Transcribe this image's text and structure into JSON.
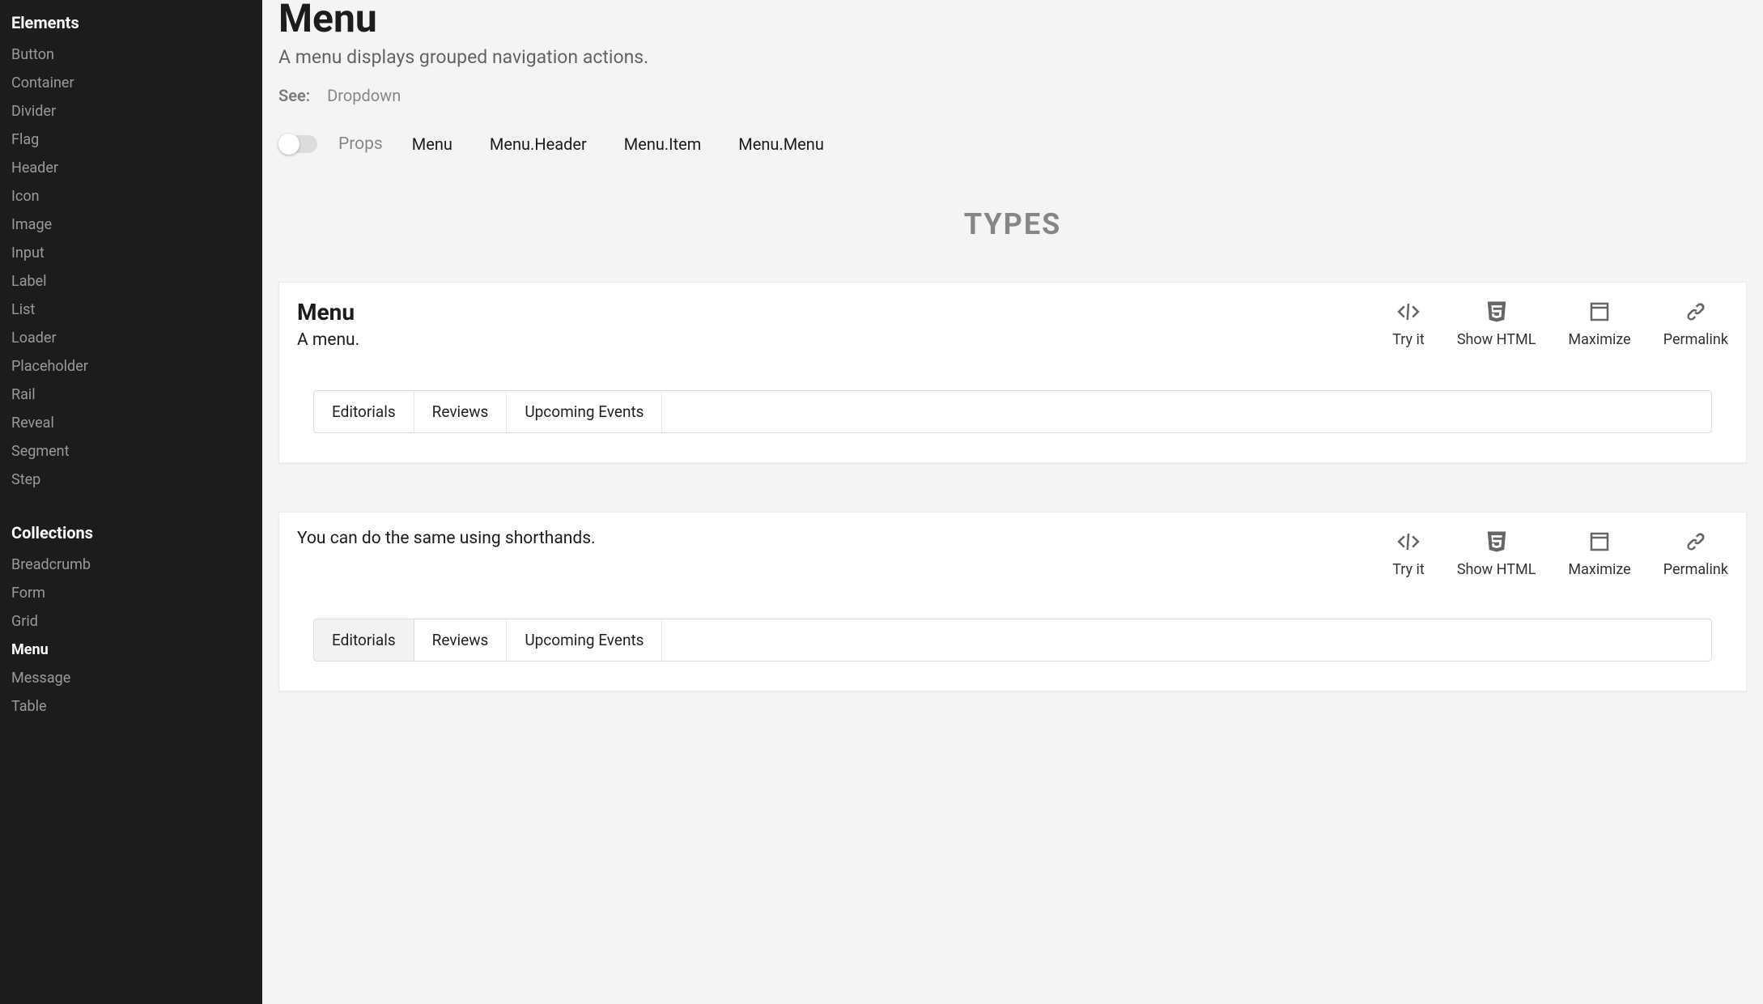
{
  "sidebar": {
    "sections": [
      {
        "title": "Elements",
        "items": [
          {
            "label": "Button",
            "active": false
          },
          {
            "label": "Container",
            "active": false
          },
          {
            "label": "Divider",
            "active": false
          },
          {
            "label": "Flag",
            "active": false
          },
          {
            "label": "Header",
            "active": false
          },
          {
            "label": "Icon",
            "active": false
          },
          {
            "label": "Image",
            "active": false
          },
          {
            "label": "Input",
            "active": false
          },
          {
            "label": "Label",
            "active": false
          },
          {
            "label": "List",
            "active": false
          },
          {
            "label": "Loader",
            "active": false
          },
          {
            "label": "Placeholder",
            "active": false
          },
          {
            "label": "Rail",
            "active": false
          },
          {
            "label": "Reveal",
            "active": false
          },
          {
            "label": "Segment",
            "active": false
          },
          {
            "label": "Step",
            "active": false
          }
        ]
      },
      {
        "title": "Collections",
        "items": [
          {
            "label": "Breadcrumb",
            "active": false
          },
          {
            "label": "Form",
            "active": false
          },
          {
            "label": "Grid",
            "active": false
          },
          {
            "label": "Menu",
            "active": true
          },
          {
            "label": "Message",
            "active": false
          },
          {
            "label": "Table",
            "active": false
          }
        ]
      }
    ]
  },
  "page": {
    "title": "Menu",
    "subtitle": "A menu displays grouped navigation actions.",
    "see_label": "See:",
    "see_link": "Dropdown",
    "props_label": "Props",
    "props_links": [
      "Menu",
      "Menu.Header",
      "Menu.Item",
      "Menu.Menu"
    ],
    "section_heading": "TYPES"
  },
  "actions": {
    "tryit": "Try it",
    "showhtml": "Show HTML",
    "maximize": "Maximize",
    "permalink": "Permalink"
  },
  "examples": [
    {
      "title": "Menu",
      "desc": "A menu.",
      "menu_items": [
        {
          "label": "Editorials",
          "active": false
        },
        {
          "label": "Reviews",
          "active": false
        },
        {
          "label": "Upcoming Events",
          "active": false
        }
      ]
    },
    {
      "title": "",
      "desc": "You can do the same using shorthands.",
      "menu_items": [
        {
          "label": "Editorials",
          "active": true
        },
        {
          "label": "Reviews",
          "active": false
        },
        {
          "label": "Upcoming Events",
          "active": false
        }
      ]
    }
  ]
}
